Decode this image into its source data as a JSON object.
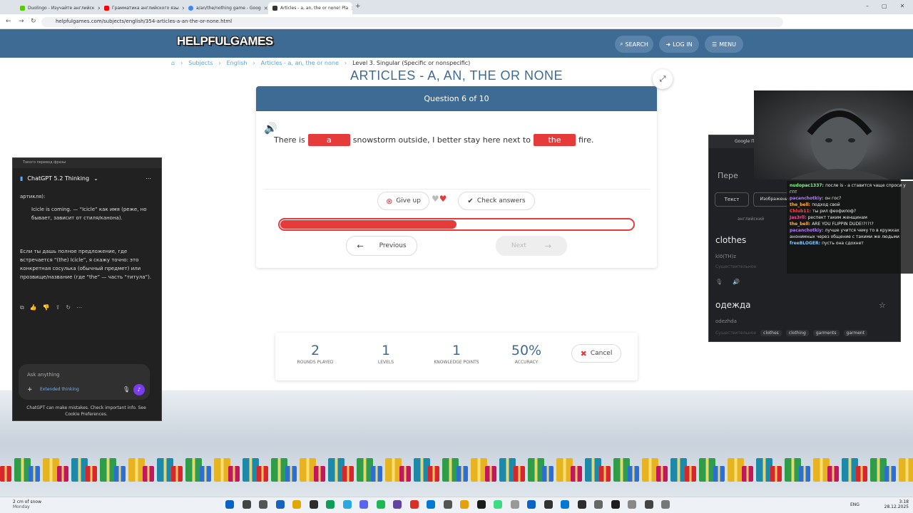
{
  "browser": {
    "tabs": [
      {
        "label": "Duolingo - Изучайте английск",
        "color": "#58cc02"
      },
      {
        "label": "Грамматика английского язы",
        "color": "#ff0000"
      },
      {
        "label": "a/an/the/nothing game - Goog",
        "color": "#4285f4"
      },
      {
        "label": "Articles - a, an, the or none! Pla",
        "color": "#333333"
      }
    ],
    "url": "helpfulgames.com/subjects/english/354-articles-a-an-the-or-none.html"
  },
  "site": {
    "logo": "HELPFULGAMES",
    "search": "SEARCH",
    "login": "LOG IN",
    "menu": "MENU"
  },
  "breadcrumb": {
    "home_icon": "home-icon",
    "items": [
      "Subjects",
      "English",
      "Articles - a, an, the or none"
    ],
    "current": "Level 3. Singular (Specific or nonspecific)"
  },
  "page_title": "ARTICLES - A, AN, THE OR NONE",
  "question": {
    "header": "Question 6 of 10",
    "parts": [
      "There is",
      "snowstorm outside, I better stay here next to",
      "fire."
    ],
    "answers": [
      "a",
      "the"
    ],
    "give_up": "Give up",
    "check": "Check answers",
    "progress": 0.5,
    "previous": "Previous",
    "next": "Next",
    "accent": "#e53b3b"
  },
  "stats": {
    "rounds": {
      "value": "2",
      "label": "ROUNDS PLAYED"
    },
    "levels": {
      "value": "1",
      "label": "LEVELS"
    },
    "knowledge": {
      "value": "1",
      "label": "KNOWLEDGE POINTS"
    },
    "accuracy": {
      "value": "50%",
      "label": "ACCURACY"
    },
    "cancel": "Cancel"
  },
  "gpt": {
    "window_title": "Такого перевод фразы",
    "model": "ChatGPT 5.2 Thinking",
    "line0": "артикля):",
    "bullet": "Icicle is coming. — “Icicle” как имя (реже, но бывает, зависит от стиля/канона).",
    "para": "Если ты дашь полное предложение, где встречается “(the) Icicle”, я скажу точно: это конкретная сосулька (обычный предмет) или прозвище/название (где “the” — часть “титула”).",
    "input_placeholder": "Ask anything",
    "mode": "Extended thinking",
    "footer": "ChatGPT can make mistakes. Check important info. See Cookie Preferences."
  },
  "translate": {
    "tab_title": "Google Пе",
    "header": "Пере",
    "text_btn": "Текст",
    "images_btn": "Изображения",
    "lang_from": "английский",
    "word": "clothes",
    "transcription": "klō(TH)z",
    "result": "одежда",
    "result_translit": "odezhda",
    "pos": "Существительное",
    "synonyms": [
      "clothes",
      "clothing",
      "garments",
      "garment"
    ]
  },
  "chat": [
    {
      "user": "nudopac1337",
      "color": "#7fff7f",
      "text": "после is - a ставится чаще спроси у гпт"
    },
    {
      "user": "pacanchotkiy",
      "color": "#b57cff",
      "text": "он гос?"
    },
    {
      "user": "the_bell",
      "color": "#ffb14a",
      "text": "подход свой"
    },
    {
      "user": "Chlub11",
      "color": "#ff4a4a",
      "text": "ты рил феофилоф?"
    },
    {
      "user": "Jas3rll",
      "color": "#ff4a9a",
      "text": "респект таким женщинам"
    },
    {
      "user": "the_bell",
      "color": "#ffb14a",
      "text": "ARE YOU FLIPPIN DUDE!?!?!?"
    },
    {
      "user": "pacanchotkiy",
      "color": "#b57cff",
      "text": "лучше учится чему то в кружках анонимных через общение с такими же людьми"
    },
    {
      "user": "freeBLOGER",
      "color": "#7fc8ff",
      "text": "пусть она сдохнет"
    }
  ],
  "taskbar": {
    "weather": "2 cm of snow",
    "day": "Monday",
    "lang": "ENG",
    "time": "3:18",
    "date": "28.12.2025"
  }
}
